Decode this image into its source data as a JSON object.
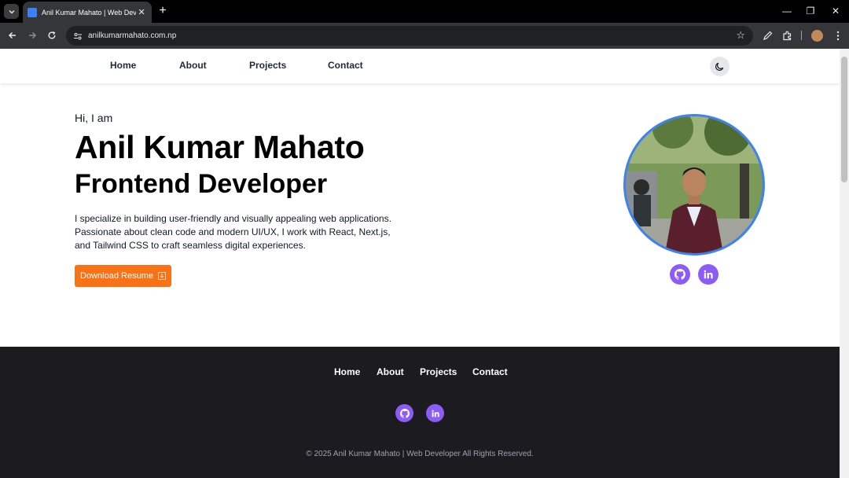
{
  "browser": {
    "tab_title": "Anil Kumar Mahato | Web Developer",
    "tab_close": "✕",
    "new_tab": "+",
    "url": "anilkumarmahato.com.np",
    "window_controls": {
      "minimize": "—",
      "restore": "❐",
      "close": "✕"
    }
  },
  "nav": {
    "items": [
      "Home",
      "About",
      "Projects",
      "Contact"
    ]
  },
  "hero": {
    "greeting": "Hi, I am",
    "name": "Anil Kumar Mahato",
    "role": "Frontend Developer",
    "description": "I specialize in building user-friendly and visually appealing web applications. Passionate about clean code and modern UI/UX, I work with React, Next.js, and Tailwind CSS to craft seamless digital experiences.",
    "resume_button": "Download Resume"
  },
  "footer": {
    "nav_items": [
      "Home",
      "About",
      "Projects",
      "Contact"
    ],
    "copyright": "© 2025 Anil Kumar Mahato | Web Developer All Rights Reserved."
  },
  "colors": {
    "accent_orange": "#f97316",
    "social_purple": "#8b5cf6",
    "avatar_border": "#3b82f6",
    "footer_bg": "#1c1b20"
  },
  "icons": [
    "github-icon",
    "linkedin-icon",
    "moon-icon",
    "download-icon",
    "star-icon",
    "extensions-icon"
  ]
}
